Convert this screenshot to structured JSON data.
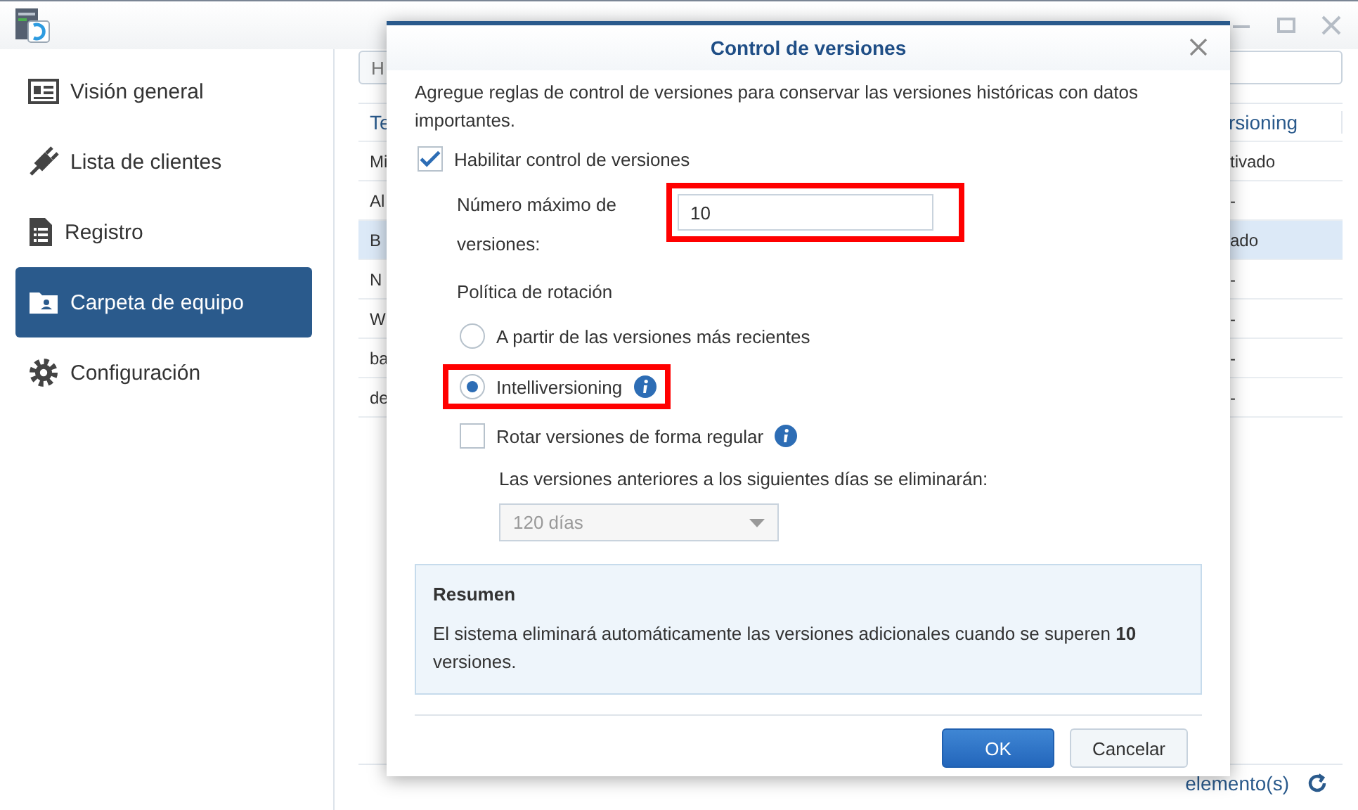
{
  "sidebar": {
    "items": [
      {
        "label": "Visión general",
        "selected": false
      },
      {
        "label": "Lista de clientes",
        "selected": false
      },
      {
        "label": "Registro",
        "selected": false
      },
      {
        "label": "Carpeta de equipo",
        "selected": true
      },
      {
        "label": "Configuración",
        "selected": false
      }
    ]
  },
  "main": {
    "search_placeholder": "H",
    "table": {
      "columns": [
        "Te",
        "rsioning"
      ],
      "rows": [
        {
          "cells": [
            "Mi",
            "tivado"
          ],
          "selected": false
        },
        {
          "cells": [
            "Al",
            "-"
          ],
          "selected": false
        },
        {
          "cells": [
            "B",
            "ado"
          ],
          "selected": true
        },
        {
          "cells": [
            "N",
            "-"
          ],
          "selected": false
        },
        {
          "cells": [
            "W",
            "-"
          ],
          "selected": false
        },
        {
          "cells": [
            "ba",
            "-"
          ],
          "selected": false
        },
        {
          "cells": [
            "de",
            "-"
          ],
          "selected": false
        }
      ]
    },
    "footer": "elemento(s)"
  },
  "dialog": {
    "title": "Control de versiones",
    "description": "Agregue reglas de control de versiones para conservar las versiones históricas con datos importantes.",
    "enable_versioning": {
      "label": "Habilitar control de versiones",
      "checked": true
    },
    "max_versions": {
      "label": "Número máximo de versiones:",
      "value": "10",
      "highlighted": true
    },
    "rotation_policy": {
      "label": "Política de rotación",
      "options": [
        {
          "label": "A partir de las versiones más recientes",
          "selected": false,
          "highlighted": false,
          "info": false
        },
        {
          "label": "Intelliversioning",
          "selected": true,
          "highlighted": true,
          "info": true
        }
      ]
    },
    "regular_rotation": {
      "label": "Rotar versiones de forma regular",
      "checked": false,
      "info": true
    },
    "delete_after": {
      "label": "Las versiones anteriores a los siguientes días se eliminarán:",
      "value": "120 días",
      "disabled": true
    },
    "summary": {
      "title": "Resumen",
      "text": "El sistema eliminará automáticamente las versiones adicionales cuando se superen **10** versiones."
    },
    "buttons": [
      {
        "label": "OK",
        "kind": "primary"
      },
      {
        "label": "Cancelar",
        "kind": "secondary"
      }
    ]
  }
}
